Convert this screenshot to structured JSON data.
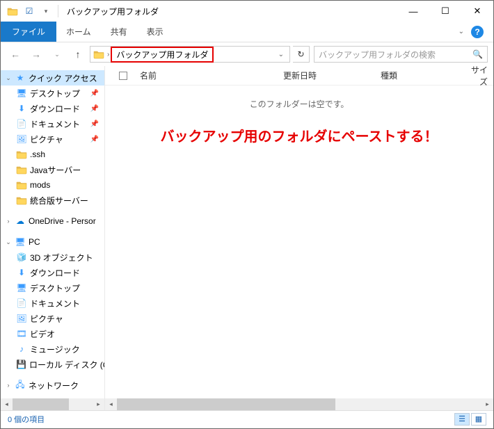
{
  "window": {
    "title": "バックアップ用フォルダ"
  },
  "ribbon": {
    "file": "ファイル",
    "home": "ホーム",
    "share": "共有",
    "view": "表示"
  },
  "address": {
    "current": "バックアップ用フォルダ"
  },
  "search": {
    "placeholder": "バックアップ用フォルダの検索"
  },
  "tree": {
    "quick_access": "クイック アクセス",
    "items_pinned": [
      {
        "label": "デスクトップ"
      },
      {
        "label": "ダウンロード"
      },
      {
        "label": "ドキュメント"
      },
      {
        "label": "ピクチャ"
      }
    ],
    "items_recent": [
      {
        "label": ".ssh"
      },
      {
        "label": "Javaサーバー"
      },
      {
        "label": "mods"
      },
      {
        "label": "統合版サーバー"
      }
    ],
    "onedrive": "OneDrive - Persor",
    "pc": "PC",
    "pc_items": [
      {
        "label": "3D オブジェクト"
      },
      {
        "label": "ダウンロード"
      },
      {
        "label": "デスクトップ"
      },
      {
        "label": "ドキュメント"
      },
      {
        "label": "ピクチャ"
      },
      {
        "label": "ビデオ"
      },
      {
        "label": "ミュージック"
      },
      {
        "label": "ローカル ディスク (C"
      }
    ],
    "network": "ネットワーク"
  },
  "columns": {
    "name": "名前",
    "date": "更新日時",
    "type": "種類",
    "size": "サイズ"
  },
  "content": {
    "empty": "このフォルダーは空です。"
  },
  "annotation": "バックアップ用のフォルダにペーストする！",
  "status": {
    "count": "0 個の項目"
  }
}
